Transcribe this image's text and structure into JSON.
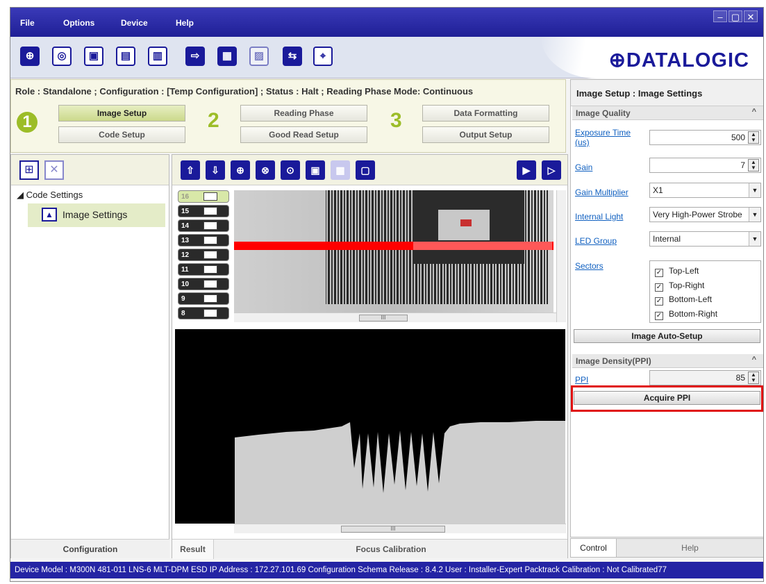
{
  "menu": [
    "File",
    "Options",
    "Device",
    "Help"
  ],
  "window_controls": {
    "minimize": "–",
    "maximize": "▢",
    "close": "✕"
  },
  "logo": "⊕DATALOGIC",
  "status_line": "Role :  Standalone ;  Configuration :  [Temp Configuration] ;  Status :  Halt ;  Reading Phase Mode: Continuous",
  "wizard": {
    "steps": [
      "1",
      "2",
      "3"
    ],
    "buttons": {
      "image_setup": "Image Setup",
      "code_setup": "Code Setup",
      "reading_phase": "Reading Phase",
      "good_read_setup": "Good Read Setup",
      "data_formatting": "Data Formatting",
      "output_setup": "Output Setup"
    }
  },
  "tree": {
    "root": "Code Settings",
    "child": "Image Settings"
  },
  "left_footer": "Configuration",
  "center": {
    "thumbnails": [
      "16",
      "15",
      "14",
      "13",
      "12",
      "11",
      "10",
      "9",
      "8"
    ],
    "tabs": {
      "result": "Result",
      "focus": "Focus Calibration"
    },
    "scroll_glyph": "III"
  },
  "right": {
    "title": "Image Setup : Image Settings",
    "image_quality": {
      "header": "Image Quality",
      "exposure_label": "Exposure Time (us)",
      "exposure_value": "500",
      "gain_label": "Gain",
      "gain_value": "7",
      "gain_multiplier_label": "Gain Multiplier",
      "gain_multiplier_value": "X1",
      "internal_light_label": "Internal Light",
      "internal_light_value": "Very High-Power Strobe",
      "led_group_label": "LED Group",
      "led_group_value": "Internal",
      "sectors_label": "Sectors",
      "sectors": [
        "Top-Left",
        "Top-Right",
        "Bottom-Left",
        "Bottom-Right"
      ],
      "auto_setup": "Image Auto-Setup"
    },
    "density": {
      "header": "Image Density(PPI)",
      "ppi_label": "PPI",
      "ppi_value": "85",
      "acquire": "Acquire PPI"
    },
    "tabs": {
      "control": "Control",
      "help": "Help"
    }
  },
  "statusbar": "Device Model : M300N   481-011   LNS-6 MLT-DPM ESD   IP Address :  172.27.101.69   Configuration Schema Release :  8.4.2   User : Installer-Expert   Packtrack Calibration : Not Calibrated77",
  "colors": {
    "menubar": "#2424a4",
    "accent_green": "#9cbd28",
    "highlight_red": "#e01010",
    "scanline_red": "#ff0000"
  }
}
